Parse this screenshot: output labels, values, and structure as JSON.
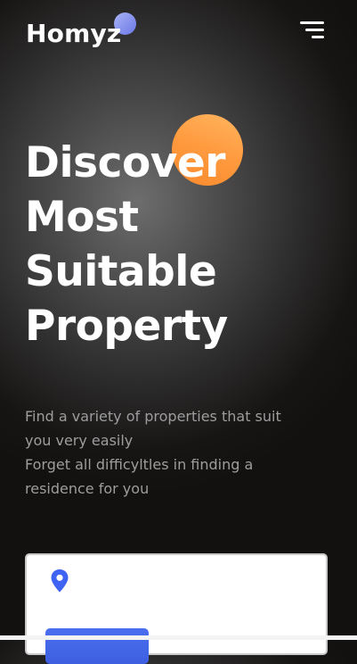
{
  "header": {
    "logo_text": "Homyz",
    "menu_icon": "hamburger-menu-icon"
  },
  "hero": {
    "title_lines": [
      "Discover",
      "Most",
      "Suitable",
      "Property"
    ],
    "subtitle_lines": [
      "Find a variety of properties that suit",
      "you very easily",
      "Forget all difficyltles in finding a",
      "residence for you"
    ]
  },
  "search": {
    "icon": "location-pin-icon",
    "button_label": ""
  },
  "colors": {
    "accent_orange": "#ff9a3e",
    "accent_blue": "#4066ff",
    "logo_dot": "#8e9aef",
    "text_muted": "#9d9d9d"
  }
}
